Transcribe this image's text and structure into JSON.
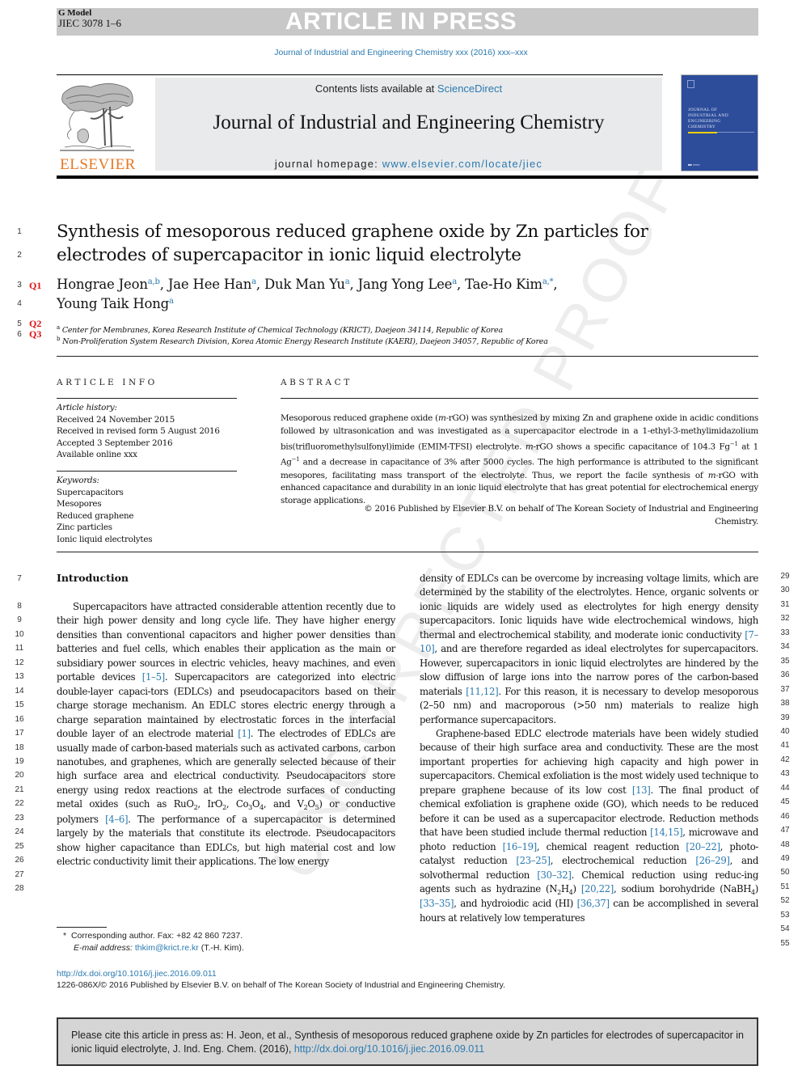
{
  "header": {
    "g_model": "G Model",
    "article_id": "JIEC 3078 1–6",
    "banner": "ARTICLE IN PRESS",
    "journal_line": "Journal of Industrial and Engineering Chemistry xxx (2016) xxx–xxx"
  },
  "masthead": {
    "contents_prefix": "Contents lists available at ",
    "contents_link": "ScienceDirect",
    "journal_title": "Journal of Industrial and Engineering Chemistry",
    "homepage_prefix": "journal homepage: ",
    "homepage_link": "www.elsevier.com/locate/jiec",
    "publisher_logo": "ELSEVIER",
    "cover_text": [
      "JOURNAL OF",
      "INDUSTRIAL AND",
      "ENGINEERING",
      "CHEMISTRY"
    ],
    "colors": {
      "publisher_orange": "#e87722",
      "link_blue": "#2a7ab0",
      "cover_blue": "#2d4d9b"
    }
  },
  "article": {
    "title_lines": [
      "Synthesis of mesoporous reduced graphene oxide by Zn particles for",
      "electrodes of supercapacitor in ionic liquid electrolyte"
    ],
    "authors": [
      {
        "name": "Hongrae Jeon",
        "aff": "a,b"
      },
      {
        "name": "Jae Hee Han",
        "aff": "a"
      },
      {
        "name": "Duk Man Yu",
        "aff": "a"
      },
      {
        "name": "Jang Yong Lee",
        "aff": "a"
      },
      {
        "name": "Tae-Ho Kim",
        "aff": "a,*"
      },
      {
        "name": "Young Taik Hong",
        "aff": "a"
      }
    ],
    "affiliations": [
      {
        "mark": "a",
        "text": "Center for Membranes, Korea Research Institute of Chemical Technology (KRICT), Daejeon 34114, Republic of Korea"
      },
      {
        "mark": "b",
        "text": "Non-Proliferation System Research Division, Korea Atomic Energy Research Institute (KAERI), Daejeon 34057, Republic of Korea"
      }
    ],
    "query_marks": [
      "Q1",
      "Q2",
      "Q3"
    ]
  },
  "article_info": {
    "heading": "ARTICLE INFO",
    "history_label": "Article history:",
    "history": [
      "Received 24 November 2015",
      "Received in revised form 5 August 2016",
      "Accepted 3 September 2016",
      "Available online xxx"
    ],
    "keywords_label": "Keywords:",
    "keywords": [
      "Supercapacitors",
      "Mesopores",
      "Reduced graphene",
      "Zinc particles",
      "Ionic liquid electrolytes"
    ]
  },
  "abstract": {
    "heading": "ABSTRACT",
    "text_1": "Mesoporous reduced graphene oxide (",
    "m1": "m",
    "text_2": "-rGO) was synthesized by mixing Zn and graphene oxide in acidic conditions followed by ultrasonication and was investigated as a supercapacitor electrode in a 1-ethyl-3-methylimidazolium bis(trifluoromethylsulfonyl)imide (EMIM-TFSI) electrolyte. ",
    "m2": "m",
    "text_3": "-rGO shows a specific capacitance of 104.3 Fg",
    "sup1": "−1",
    "text_4": " at 1 Ag",
    "sup2": "−1",
    "text_5": " and a decrease in capacitance of 3% after 5000 cycles. The high performance is attributed to the significant mesopores, facilitating mass transport of the electrolyte. Thus, we report the facile synthesis of ",
    "m3": "m",
    "text_6": "-rGO with enhanced capacitance and durability in an ionic liquid electrolyte that has great potential for electrochemical energy storage applications.",
    "copyright_1": "© 2016 Published by Elsevier B.V. on behalf of The Korean Society of Industrial and Engineering",
    "copyright_2": "Chemistry."
  },
  "body": {
    "intro_heading": "Introduction",
    "left_column": [
      "Supercapacitors have attracted considerable attention recently due to their high power density and long cycle life. They have higher energy densities than conventional capacitors and higher power densities than batteries and fuel cells, which enables their application as the main or subsidiary power sources in electric vehicles, heavy machines, and even portable devices ",
      "[1–5]",
      ". Supercapacitors are categorized into electric double-layer capaci-tors (EDLCs) and pseudocapacitors based on their charge storage mechanism. An EDLC stores electric energy through a charge separation maintained by electrostatic forces in the interfacial double layer of an electrode material ",
      "[1]",
      ". The electrodes of EDLCs are usually made of carbon-based materials such as activated carbons, carbon nanotubes, and graphenes, which are generally selected because of their high surface area and electrical conductivity. Pseudocapacitors store energy using redox reactions at the electrode surfaces of conducting metal oxides (such as RuO",
      "2",
      ", IrO",
      "2",
      ", Co",
      "3",
      "O",
      "4",
      ", and V",
      "2",
      "O",
      "5",
      ") or conductive polymers ",
      "[4–6]",
      ". The performance of a supercapacitor is determined largely by the materials that constitute its electrode. Pseudocapacitors show higher capacitance than EDLCs, but high material cost and low electric conductivity limit their applications. The low energy"
    ],
    "right_para_1": [
      "density of EDLCs can be overcome by increasing voltage limits, which are determined by the stability of the electrolytes. Hence, organic solvents or ionic liquids are widely used as electrolytes for high energy density supercapacitors. Ionic liquids have wide electrochemical windows, high thermal and electrochemical stability, and moderate ionic conductivity ",
      "[7–10]",
      ", and are therefore regarded as ideal electrolytes for supercapacitors. However, supercapacitors in ionic liquid electrolytes are hindered by the slow diffusion of large ions into the narrow pores of the carbon-based materials ",
      "[11,12]",
      ". For this reason, it is necessary to develop mesoporous (2–50 nm) and macroporous (>50 nm) materials to realize high performance supercapacitors."
    ],
    "right_para_2": [
      "Graphene-based EDLC electrode materials have been widely studied because of their high surface area and conductivity. These are the most important properties for achieving high capacity and high power in supercapacitors. Chemical exfoliation is the most widely used technique to prepare graphene because of its low cost ",
      "[13]",
      ". The final product of chemical exfoliation is graphene oxide (GO), which needs to be reduced before it can be used as a supercapacitor electrode. Reduction methods that have been studied include thermal reduction ",
      "[14,15]",
      ", microwave and photo reduction ",
      "[16–19]",
      ", chemical reagent reduction ",
      "[20–22]",
      ", photo-catalyst reduction ",
      "[23–25]",
      ", electrochemical reduction ",
      "[26–29]",
      ", and solvothermal reduction ",
      "[30–32]",
      ". Chemical reduction using reduc-ing agents such as hydrazine (N",
      "2",
      "H",
      "4",
      ") ",
      "[20,22]",
      ", sodium borohydride (NaBH",
      "4",
      ") ",
      "[33–35]",
      ", and hydroiodic acid (HI) ",
      "[36,37]",
      " can be accomplished in several hours at relatively low temperatures"
    ],
    "line_numbers_left": [
      "1",
      "2",
      "3",
      "4",
      "5",
      "6",
      "7",
      "8",
      "9",
      "10",
      "11",
      "12",
      "13",
      "14",
      "15",
      "16",
      "17",
      "18",
      "19",
      "20",
      "21",
      "22",
      "23",
      "24",
      "25",
      "26",
      "27",
      "28"
    ],
    "line_numbers_right": [
      "29",
      "30",
      "31",
      "32",
      "33",
      "34",
      "35",
      "36",
      "37",
      "38",
      "39",
      "40",
      "41",
      "42",
      "43",
      "44",
      "45",
      "46",
      "47",
      "48",
      "49",
      "50",
      "51",
      "52",
      "53",
      "54",
      "55"
    ]
  },
  "footnotes": {
    "star": "*",
    "corresponding": "Corresponding author. Fax: +82 42 860 7237.",
    "email_label": "E-mail address: ",
    "email": "thkim@krict.re.kr",
    "email_suffix": " (T.-H. Kim).",
    "doi": "http://dx.doi.org/10.1016/j.jiec.2016.09.011",
    "issn": "1226-086X/© 2016 Published by Elsevier B.V. on behalf of The Korean Society of Industrial and Engineering Chemistry."
  },
  "citation_box": {
    "text": "Please cite this article in press as: H. Jeon, et al., Synthesis of mesoporous reduced graphene oxide by Zn particles for electrodes of supercapacitor in ionic liquid electrolyte, J. Ind. Eng. Chem. (2016), ",
    "link": "http://dx.doi.org/10.1016/j.jiec.2016.09.011"
  },
  "watermark": "UNCORRECTED PROOF"
}
